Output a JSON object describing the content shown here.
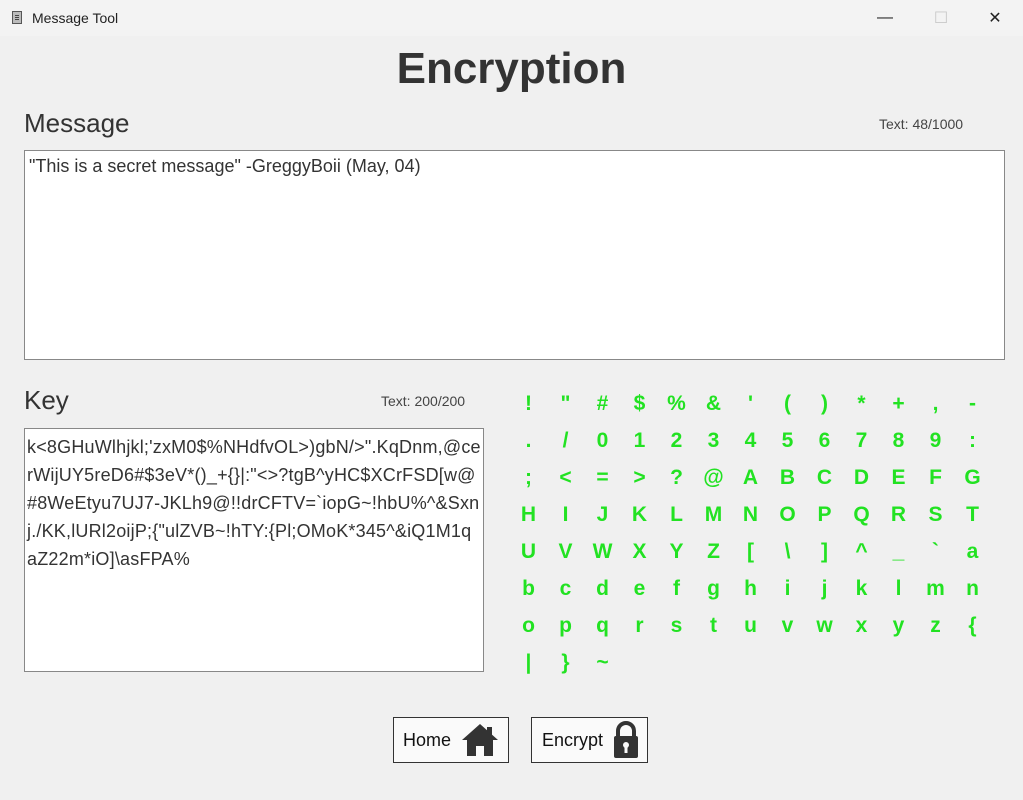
{
  "window": {
    "title": "Message Tool",
    "minimize_glyph": "—",
    "maximize_glyph": "☐",
    "close_glyph": "✕"
  },
  "heading": "Encryption",
  "message": {
    "label": "Message",
    "counter": "Text: 48/1000",
    "value": "\"This is a secret message\" -GreggyBoii (May, 04)"
  },
  "key": {
    "label": "Key",
    "counter": "Text: 200/200",
    "value": "k<8GHuWlhjkl;'zxM0$%NHdfvOL>)gbN/>\".KqDnm,@cerWijUY5reD6#$3eV*()_+{}|:\"<>?tgB^yHC$XCrFSD[w@#8WeEtyu7UJ7-JKLh9@!!drCFTV=`iopG~!hbU%^&Sxnj./KK,lURl2oijP;{\"ulZVB~!hTY:{Pl;OMoK*345^&iQ1M1qaZ22m*iO]\\asFPA%"
  },
  "charset": [
    "!",
    "\"",
    "#",
    "$",
    "%",
    "&",
    "'",
    "(",
    ")",
    "*",
    "+",
    ",",
    "-",
    ".",
    "/",
    "0",
    "1",
    "2",
    "3",
    "4",
    "5",
    "6",
    "7",
    "8",
    "9",
    ":",
    ";",
    "<",
    "=",
    ">",
    "?",
    "@",
    "A",
    "B",
    "C",
    "D",
    "E",
    "F",
    "G",
    "H",
    "I",
    "J",
    "K",
    "L",
    "M",
    "N",
    "O",
    "P",
    "Q",
    "R",
    "S",
    "T",
    "U",
    "V",
    "W",
    "X",
    "Y",
    "Z",
    "[",
    "\\",
    "]",
    "^",
    "_",
    "`",
    "a",
    "b",
    "c",
    "d",
    "e",
    "f",
    "g",
    "h",
    "i",
    "j",
    "k",
    "l",
    "m",
    "n",
    "o",
    "p",
    "q",
    "r",
    "s",
    "t",
    "u",
    "v",
    "w",
    "x",
    "y",
    "z",
    "{",
    "|",
    "}",
    "~"
  ],
  "buttons": {
    "home_label": "Home",
    "home_icon": "home-icon",
    "encrypt_label": "Encrypt",
    "encrypt_icon": "lock-icon"
  },
  "colors": {
    "charset_glyph": "#22e222",
    "background": "#f0f0f0"
  }
}
